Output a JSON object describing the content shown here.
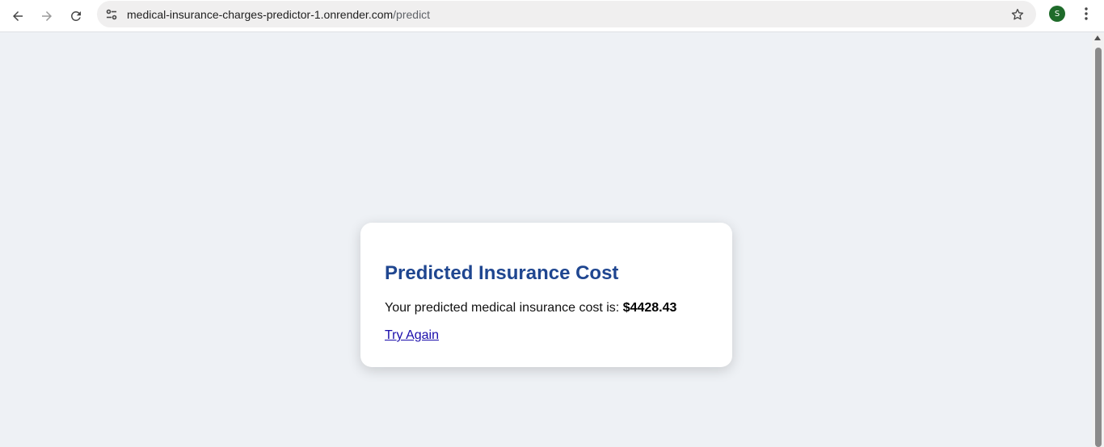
{
  "browser": {
    "url_host": "medical-insurance-charges-predictor-1.onrender.com",
    "url_path": "/predict",
    "profile_initial": "S",
    "icons": {
      "back": "back-arrow-icon",
      "forward": "forward-arrow-icon",
      "reload": "reload-icon",
      "site_info": "tune-icon",
      "bookmark": "star-icon",
      "menu": "more-vert-icon"
    }
  },
  "card": {
    "title": "Predicted Insurance Cost",
    "result_prefix": "Your predicted medical insurance cost is:",
    "result_value": "$4428.43",
    "try_again_label": "Try Again"
  },
  "colors": {
    "page_background": "#eef1f5",
    "title": "#1f4690",
    "link": "#1a0dab",
    "avatar": "#1e6b2a"
  }
}
